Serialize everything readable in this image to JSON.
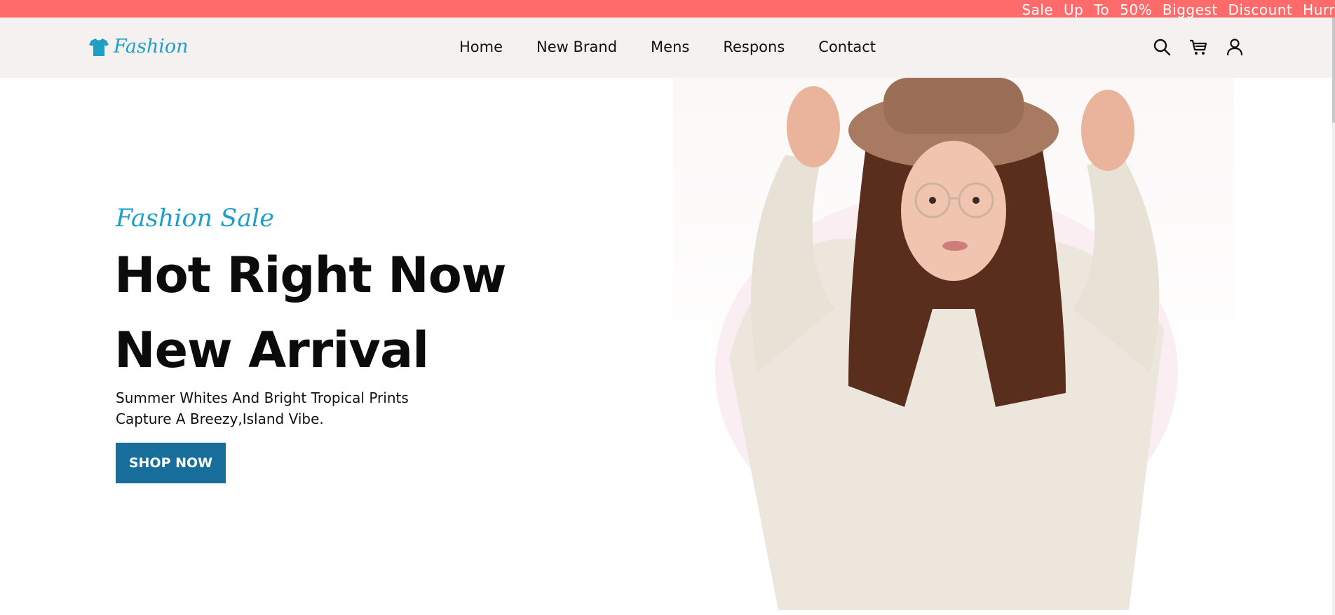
{
  "promo": {
    "text": "Sale  Up  To  50%  Biggest  Discount  Hurr"
  },
  "brand": {
    "name": "Fashion",
    "icon": "tshirt-icon",
    "color": "#1e9fc8"
  },
  "nav": {
    "links": [
      {
        "label": "Home"
      },
      {
        "label": "New Brand"
      },
      {
        "label": "Mens"
      },
      {
        "label": "Respons"
      },
      {
        "label": "Contact"
      }
    ],
    "icons": [
      "search-icon",
      "cart-icon",
      "user-icon"
    ]
  },
  "hero": {
    "kicker": "Fashion Sale",
    "headline_1": "Hot Right Now",
    "headline_2": "New Arrival",
    "description": "Summer Whites And Bright Tropical Prints Capture A Breezy,Island Vibe.",
    "cta": "SHOP NOW",
    "image_alt": "woman in hat and sweater"
  },
  "colors": {
    "promo_bg": "#ff6b6b",
    "nav_bg": "#f4f1f0",
    "accent": "#1e9fc8",
    "button_bg": "#176e9a"
  }
}
